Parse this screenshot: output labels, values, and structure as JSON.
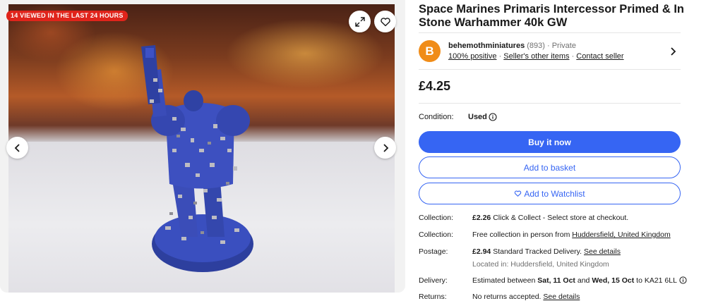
{
  "gallery": {
    "viewed_badge": "14 VIEWED IN THE LAST 24 HOURS"
  },
  "listing": {
    "title": "Space Marines Primaris Intercessor Primed & In Stone Warhammer 40k GW",
    "price": "£4.25",
    "condition_label": "Condition:",
    "condition_value": "Used"
  },
  "seller": {
    "avatar_letter": "B",
    "name": "behemothminiatures",
    "feedback_count": "(893)",
    "account_type": "· Private",
    "positive": "100% positive",
    "other_items": "Seller's other items",
    "contact": "Contact seller"
  },
  "actions": {
    "buy_now": "Buy it now",
    "add_basket": "Add to basket",
    "add_watchlist": "Add to Watchlist"
  },
  "shipping": {
    "collection1": {
      "label": "Collection:",
      "amount": "£2.26",
      "text": "Click & Collect - Select store at checkout."
    },
    "collection2": {
      "label": "Collection:",
      "text": "Free collection in person from",
      "location": "Huddersfield, United Kingdom"
    },
    "postage": {
      "label": "Postage:",
      "amount": "£2.94",
      "text": "Standard Tracked Delivery.",
      "link": "See details",
      "located": "Located in: Huddersfield, United Kingdom"
    },
    "delivery": {
      "label": "Delivery:",
      "prefix": "Estimated between",
      "date1": "Sat, 11 Oct",
      "and": "and",
      "date2": "Wed, 15 Oct",
      "suffix": "to KA21 6LL"
    },
    "returns": {
      "label": "Returns:",
      "text": "No returns accepted.",
      "link": "See details"
    }
  },
  "colors": {
    "primary": "#3665f3",
    "badge": "#e0241b",
    "avatar": "#f08c18"
  }
}
